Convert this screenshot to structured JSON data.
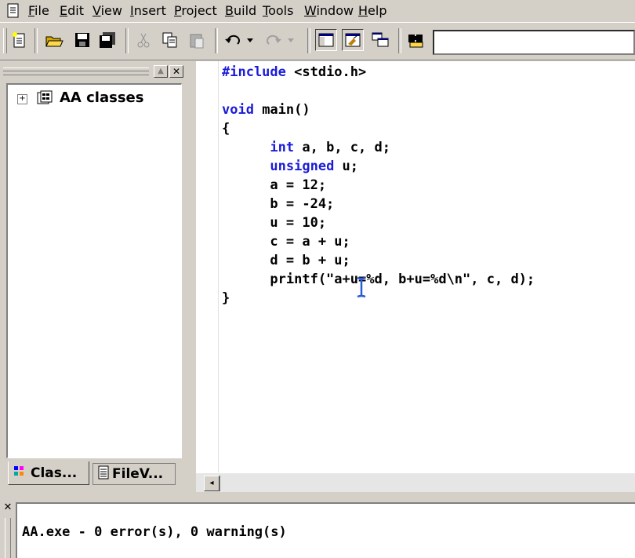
{
  "menu": [
    {
      "label": "File",
      "u": "F",
      "rest": "ile"
    },
    {
      "label": "Edit",
      "u": "E",
      "rest": "dit"
    },
    {
      "label": "View",
      "u": "V",
      "rest": "iew"
    },
    {
      "label": "Insert",
      "u": "I",
      "rest": "nsert"
    },
    {
      "label": "Project",
      "u": "P",
      "rest": "roject"
    },
    {
      "label": "Build",
      "u": "B",
      "rest": "uild"
    },
    {
      "label": "Tools",
      "u": "T",
      "rest": "ools"
    },
    {
      "label": "Window",
      "u": "W",
      "rest": "indow"
    },
    {
      "label": "Help",
      "u": "H",
      "rest": "elp"
    }
  ],
  "workspace": {
    "tree_root": "AA classes",
    "tabs": [
      "Clas...",
      "FileV..."
    ]
  },
  "editor": {
    "lines": [
      "#include <stdio.h>",
      "",
      "void main()",
      "{",
      "      int a, b, c, d;",
      "      unsigned u;",
      "      a = 12;",
      "      b = -24;",
      "      u = 10;",
      "      c = a + u;",
      "      d = b + u;",
      "      printf(\"a+u=%d, b+u=%d\\n\", c, d);",
      "}"
    ]
  },
  "output": {
    "text": "AA.exe - 0 error(s), 0 warning(s)"
  },
  "colors": {
    "keyword": "#1b1bd8",
    "chrome": "#d4d0c8"
  },
  "icons": [
    "new-file-icon",
    "open-folder-icon",
    "save-icon",
    "save-all-icon",
    "cut-icon",
    "copy-icon",
    "paste-icon",
    "undo-icon",
    "redo-icon",
    "workspace-icon",
    "output-icon",
    "window-list-icon",
    "find-in-files-icon"
  ]
}
